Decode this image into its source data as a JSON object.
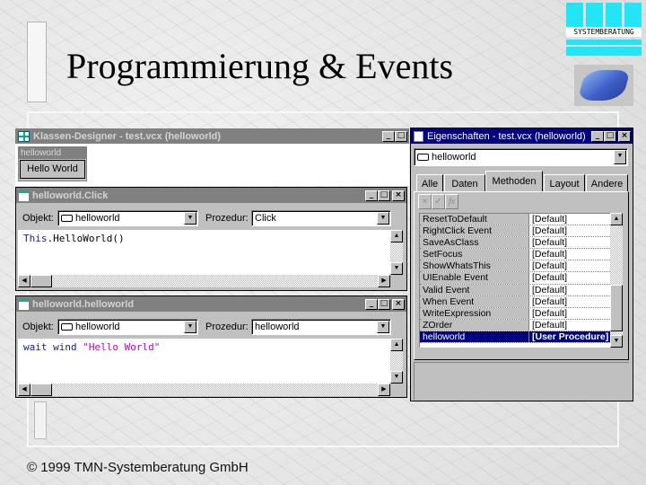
{
  "slide": {
    "title": "Programmierung & Events",
    "footer": "© 1999 TMN-Systemberatung GmbH",
    "logo_subtitle": "SYSTEMBERATUNG",
    "brand_color": "#22e5f5"
  },
  "class_designer": {
    "title": "Klassen-Designer - test.vcx (helloworld)",
    "form_caption": "helloworld",
    "button_label": "Hello World",
    "buttons": {
      "minimize": "_",
      "maximize": "□"
    }
  },
  "code_window_click": {
    "title": "helloworld.Click",
    "object_label": "Objekt:",
    "object_value": "helloworld",
    "procedure_label": "Prozedur:",
    "procedure_value": "Click",
    "code": {
      "keyword": "This",
      "rest": ".HelloWorld()"
    },
    "buttons": {
      "minimize": "_",
      "maximize": "□",
      "close": "×"
    }
  },
  "code_window_helloworld": {
    "title": "helloworld.helloworld",
    "object_label": "Objekt:",
    "object_value": "helloworld",
    "procedure_label": "Prozedur:",
    "procedure_value": "helloworld",
    "code": {
      "keyword": "wait wind",
      "string": "\"Hello World\""
    },
    "buttons": {
      "minimize": "_",
      "maximize": "□",
      "close": "×"
    }
  },
  "properties": {
    "title": "Eigenschaften - test.vcx (helloworld)",
    "object_value": "helloworld",
    "tabs": [
      {
        "label": "Alle"
      },
      {
        "label": "Daten"
      },
      {
        "label": "Methoden",
        "selected": true
      },
      {
        "label": "Layout"
      },
      {
        "label": "Andere"
      }
    ],
    "toolbar": {
      "cancel": "×",
      "accept": "✓",
      "function": "fx"
    },
    "rows": [
      {
        "name": "ResetToDefault",
        "value": "[Default]"
      },
      {
        "name": "RightClick Event",
        "value": "[Default]"
      },
      {
        "name": "SaveAsClass",
        "value": "[Default]"
      },
      {
        "name": "SetFocus",
        "value": "[Default]"
      },
      {
        "name": "ShowWhatsThis",
        "value": "[Default]"
      },
      {
        "name": "UIEnable Event",
        "value": "[Default]"
      },
      {
        "name": "Valid Event",
        "value": "[Default]"
      },
      {
        "name": "When Event",
        "value": "[Default]"
      },
      {
        "name": "WriteExpression",
        "value": "[Default]"
      },
      {
        "name": "ZOrder",
        "value": "[Default]"
      },
      {
        "name": "helloworld",
        "value": "[User Procedure]",
        "selected": true
      }
    ],
    "buttons": {
      "minimize": "_",
      "maximize": "□",
      "close": "×"
    }
  }
}
